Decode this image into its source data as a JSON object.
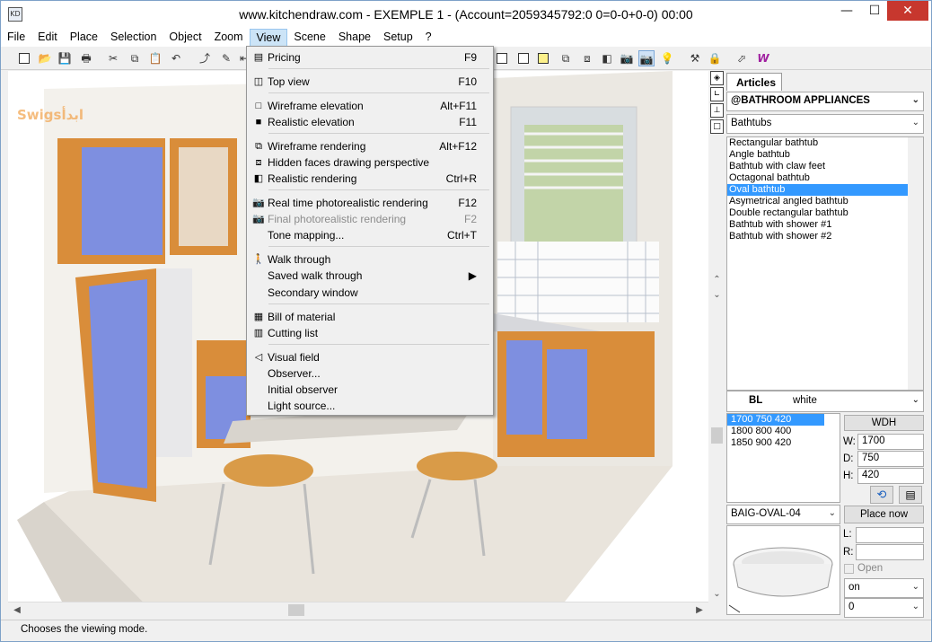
{
  "window": {
    "title": "www.kitchendraw.com - EXEMPLE 1 - (Account=2059345792:0 0=0-0+0-0) 00:00",
    "icon_text": "KD",
    "min": "—",
    "max": "☐",
    "close": "✕"
  },
  "menubar": [
    "File",
    "Edit",
    "Place",
    "Selection",
    "Object",
    "Zoom",
    "View",
    "Scene",
    "Shape",
    "Setup",
    "?"
  ],
  "active_menu": "View",
  "view_menu": [
    {
      "label": "Pricing",
      "shortcut": "F9",
      "icon": "pricing-icon",
      "glyph": "▤",
      "disabled": false
    },
    {
      "label": "Top view",
      "shortcut": "F10",
      "icon": "top-view-icon",
      "glyph": "◫",
      "disabled": false
    },
    {
      "label": "Wireframe elevation",
      "shortcut": "Alt+F11",
      "icon": "wireframe-elevation-icon",
      "glyph": "□",
      "disabled": false
    },
    {
      "label": "Realistic elevation",
      "shortcut": "F11",
      "icon": "realistic-elevation-icon",
      "glyph": "■",
      "disabled": false
    },
    {
      "label": "Wireframe rendering",
      "shortcut": "Alt+F12",
      "icon": "wireframe-rendering-icon",
      "glyph": "⧉",
      "disabled": false
    },
    {
      "label": "Hidden faces drawing perspective",
      "shortcut": "",
      "icon": "hidden-faces-icon",
      "glyph": "⧈",
      "disabled": false
    },
    {
      "label": "Realistic rendering",
      "shortcut": "Ctrl+R",
      "icon": "realistic-rendering-icon",
      "glyph": "◧",
      "disabled": false
    },
    {
      "label": "Real time photorealistic rendering",
      "shortcut": "F12",
      "icon": "camera-icon",
      "glyph": "📷",
      "disabled": false
    },
    {
      "label": "Final photorealistic rendering",
      "shortcut": "F2",
      "icon": "camera-icon",
      "glyph": "📷",
      "disabled": true
    },
    {
      "label": "Tone mapping...",
      "shortcut": "Ctrl+T",
      "icon": "",
      "glyph": "",
      "disabled": false
    },
    {
      "label": "Walk through",
      "shortcut": "",
      "icon": "walk-icon",
      "glyph": "🚶",
      "disabled": false
    },
    {
      "label": "Saved walk through",
      "shortcut": "▶",
      "icon": "",
      "glyph": "",
      "disabled": false
    },
    {
      "label": "Secondary window",
      "shortcut": "",
      "icon": "",
      "glyph": "",
      "disabled": false
    },
    {
      "label": "Bill of material",
      "shortcut": "",
      "icon": "bill-icon",
      "glyph": "▦",
      "disabled": false
    },
    {
      "label": "Cutting list",
      "shortcut": "",
      "icon": "cutting-list-icon",
      "glyph": "▥",
      "disabled": false
    },
    {
      "label": "Visual field",
      "shortcut": "",
      "icon": "visual-field-icon",
      "glyph": "◁",
      "disabled": false
    },
    {
      "label": "Observer...",
      "shortcut": "",
      "icon": "",
      "glyph": "",
      "disabled": false
    },
    {
      "label": "Initial observer",
      "shortcut": "",
      "icon": "",
      "glyph": "",
      "disabled": false
    },
    {
      "label": "Light source...",
      "shortcut": "",
      "icon": "",
      "glyph": "",
      "disabled": false
    }
  ],
  "articles": {
    "tab": "Articles",
    "catalog": "@BATHROOM APPLIANCES",
    "category": "Bathtubs",
    "items": [
      "Rectangular bathtub",
      "Angle bathtub",
      "Bathtub with claw feet",
      "Octagonal bathtub",
      "Oval bathtub",
      "Asymetrical angled bathtub",
      "Double rectangular bathtub",
      "Bathtub with shower #1",
      "Bathtub with shower #2"
    ],
    "selected_index": 4,
    "finish_code": "BL",
    "finish_name": "white",
    "sizes": [
      "1700  750  420",
      "1800  800  400",
      "1850  900  420"
    ],
    "selected_size": 0,
    "wdh_button": "WDH",
    "w_label": "W:",
    "w_value": "1700",
    "d_label": "D:",
    "d_value": "750",
    "h_label": "H:",
    "h_value": "420",
    "code": "BAIG-OVAL-04",
    "place_now": "Place now",
    "l_label": "L:",
    "r_label": "R:",
    "open_label": "Open",
    "on_value": "on",
    "zero_value": "0"
  },
  "watermark": "Swigsابدأ",
  "status": "Chooses the viewing mode."
}
